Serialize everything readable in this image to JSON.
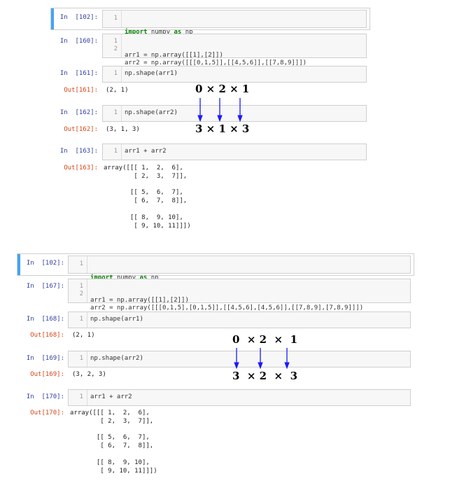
{
  "notebook1": {
    "cells": [
      {
        "in_prompt": "In  [102]:",
        "lines": [
          "1"
        ],
        "code": [
          [
            "import",
            " numpy ",
            "as",
            " np"
          ]
        ]
      },
      {
        "in_prompt": "In  [160]:",
        "lines": [
          "1",
          "2"
        ],
        "code": [
          "arr1 = np.array([[1],[2]])",
          "arr2 = np.array([[[0,1,5]],[[4,5,6]],[[7,8,9]]])"
        ]
      },
      {
        "in_prompt": "In  [161]:",
        "lines": [
          "1"
        ],
        "code": [
          "np.shape(arr1)"
        ],
        "out_prompt": "Out[161]:",
        "output": "(2, 1)"
      },
      {
        "in_prompt": "In  [162]:",
        "lines": [
          "1"
        ],
        "code": [
          "np.shape(arr2)"
        ],
        "out_prompt": "Out[162]:",
        "output": "(3, 1, 3)"
      },
      {
        "in_prompt": "In  [163]:",
        "lines": [
          "1"
        ],
        "code": [
          "arr1 + arr2"
        ],
        "out_prompt": "Out[163]:",
        "output": "array([[[ 1,  2,  6],\n        [ 2,  3,  7]],\n\n       [[ 5,  6,  7],\n        [ 6,  7,  8]],\n\n       [[ 8,  9, 10],\n        [ 9, 10, 11]]])"
      }
    ],
    "annotation_top": "0 × 2 × 1",
    "annotation_bottom": "3 × 1 × 3"
  },
  "notebook2": {
    "cells": [
      {
        "in_prompt": "In  [102]:",
        "lines": [
          "1"
        ],
        "code": [
          [
            "import",
            " numpy ",
            "as",
            " np"
          ]
        ]
      },
      {
        "in_prompt": "In  [167]:",
        "lines": [
          "1",
          "2"
        ],
        "code": [
          "arr1 = np.array([[1],[2]])",
          "arr2 = np.array([[[0,1,5],[0,1,5]],[[4,5,6],[4,5,6]],[[7,8,9],[7,8,9]]])"
        ]
      },
      {
        "in_prompt": "In  [168]:",
        "lines": [
          "1"
        ],
        "code": [
          "np.shape(arr1)"
        ],
        "out_prompt": "Out[168]:",
        "output": "(2, 1)"
      },
      {
        "in_prompt": "In  [169]:",
        "lines": [
          "1"
        ],
        "code": [
          "np.shape(arr2)"
        ],
        "out_prompt": "Out[169]:",
        "output": "(3, 2, 3)"
      },
      {
        "in_prompt": "In  [170]:",
        "lines": [
          "1"
        ],
        "code": [
          "arr1 + arr2"
        ],
        "out_prompt": "Out[170]:",
        "output": "array([[[ 1,  2,  6],\n        [ 2,  3,  7]],\n\n       [[ 5,  6,  7],\n        [ 6,  7,  8]],\n\n       [[ 8,  9, 10],\n        [ 9, 10, 11]]])"
      }
    ],
    "annotation_top": "0  × 2  ×  1",
    "annotation_bottom": "3  × 2  ×  3"
  },
  "colors": {
    "prompt_in": "#303f9f",
    "prompt_out": "#d84315",
    "arrow": "#1a1aff",
    "selected_bar": "#42a5f5"
  }
}
